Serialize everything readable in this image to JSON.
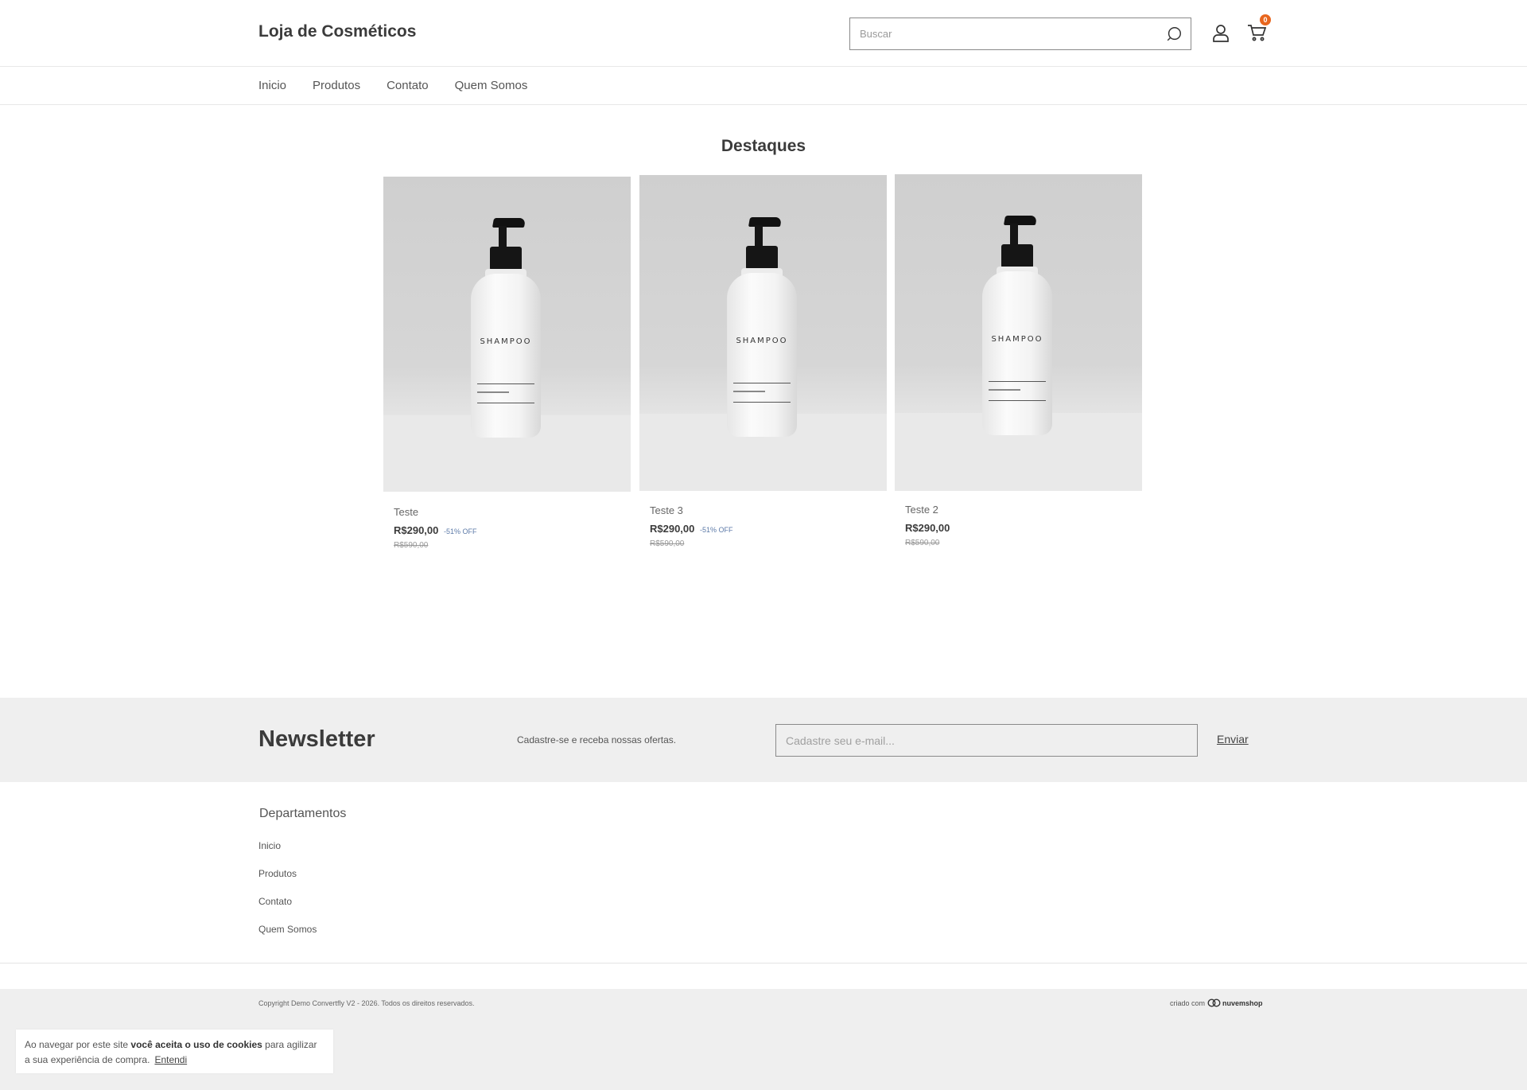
{
  "header": {
    "store_name": "Loja de Cosméticos",
    "search_placeholder": "Buscar",
    "cart_count": "0"
  },
  "nav": {
    "items": [
      "Inicio",
      "Produtos",
      "Contato",
      "Quem Somos"
    ]
  },
  "featured": {
    "title": "Destaques",
    "products": [
      {
        "name": "Teste",
        "price": "R$290,00",
        "discount": "-51% OFF",
        "old_price": "R$590,00",
        "image_label": "SHAMPOO"
      },
      {
        "name": "Teste 3",
        "price": "R$290,00",
        "discount": "-51% OFF",
        "old_price": "R$590,00",
        "image_label": "SHAMPOO"
      },
      {
        "name": "Teste 2",
        "price": "R$290,00",
        "discount": "",
        "old_price": "R$590,00",
        "image_label": "SHAMPOO"
      }
    ]
  },
  "newsletter": {
    "title": "Newsletter",
    "text": "Cadastre-se e receba nossas ofertas.",
    "input_placeholder": "Cadastre seu e-mail...",
    "button_label": "Enviar"
  },
  "footer": {
    "departments_title": "Departamentos",
    "links": [
      "Inicio",
      "Produtos",
      "Contato",
      "Quem Somos"
    ],
    "copyright": "Copyright Demo Convertfly V2 - 2026. Todos os direitos reservados.",
    "created_with": "criado com",
    "platform": "nuvemshop"
  },
  "cookie_banner": {
    "text_before": "Ao navegar por este site ",
    "text_bold": "você aceita o uso de cookies",
    "text_after": " para agilizar a sua experiência de compra.",
    "accept_label": "Entendi"
  },
  "colors": {
    "accent_badge": "#e8661e",
    "discount": "#5c7aa8",
    "band_background": "#efefef"
  }
}
